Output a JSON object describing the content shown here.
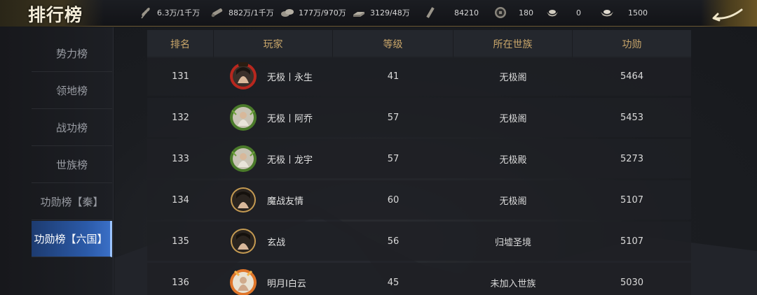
{
  "header": {
    "title": "排行榜",
    "resources": [
      {
        "icon": "wheat-icon",
        "value": "6.3万/1千万"
      },
      {
        "icon": "wood-icon",
        "value": "882万/1千万"
      },
      {
        "icon": "stone-icon",
        "value": "177万/970万"
      },
      {
        "icon": "iron-icon",
        "value": "3129/48万"
      },
      {
        "icon": "command-icon",
        "value": "84210"
      },
      {
        "icon": "copper-coin-icon",
        "value": "180"
      },
      {
        "icon": "gold-ingot-icon",
        "value": "0"
      },
      {
        "icon": "silver-ingot-icon",
        "value": "1500"
      }
    ]
  },
  "sidebar": {
    "items": [
      {
        "label": "势力榜",
        "active": false
      },
      {
        "label": "领地榜",
        "active": false
      },
      {
        "label": "战功榜",
        "active": false
      },
      {
        "label": "世族榜",
        "active": false
      },
      {
        "label": "功勋榜【秦】",
        "active": false
      },
      {
        "label": "功勋榜【六国】",
        "active": true
      }
    ]
  },
  "table": {
    "columns": [
      "排名",
      "玩家",
      "等级",
      "所在世族",
      "功勋"
    ],
    "rows": [
      {
        "rank": "131",
        "player": "无极丨永生",
        "level": "41",
        "clan": "无极阁",
        "merit": "5464",
        "avatar": "avatar-red-frame"
      },
      {
        "rank": "132",
        "player": "无极丨阿乔",
        "level": "57",
        "clan": "无极阁",
        "merit": "5453",
        "avatar": "avatar-green-frame"
      },
      {
        "rank": "133",
        "player": "无极丨龙宇",
        "level": "57",
        "clan": "无极殿",
        "merit": "5273",
        "avatar": "avatar-green-frame"
      },
      {
        "rank": "134",
        "player": "魔战友情",
        "level": "60",
        "clan": "无极阁",
        "merit": "5107",
        "avatar": "avatar-plain"
      },
      {
        "rank": "135",
        "player": "玄战",
        "level": "56",
        "clan": "归墟圣境",
        "merit": "5107",
        "avatar": "avatar-plain"
      },
      {
        "rank": "136",
        "player": "明月I白云",
        "level": "45",
        "clan": "未加入世族",
        "merit": "5030",
        "avatar": "avatar-orange-frame"
      }
    ]
  },
  "colors": {
    "accent_gold": "#c9a66a",
    "active_tab": "#2b5aa8",
    "header_bg": "#24272d"
  }
}
